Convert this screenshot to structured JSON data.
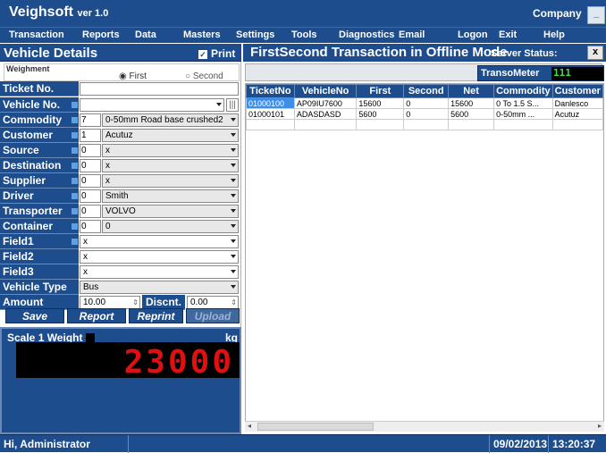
{
  "app": {
    "title": "Veighsoft",
    "version": "ver 1.0",
    "company": "Company",
    "minimize": "_"
  },
  "menu": [
    "Transaction",
    "Reports",
    "Data",
    "Masters",
    "Settings",
    "Tools",
    "Diagnostics",
    "Email",
    "Logon",
    "Exit",
    "Help"
  ],
  "left_panel": {
    "title": "Vehicle Details",
    "print_label": "Print",
    "weighment": {
      "label": "Weighment",
      "first": "First",
      "second": "Second"
    },
    "fields": {
      "ticket": {
        "label": "Ticket No.",
        "value": ""
      },
      "vehicle": {
        "label": "Vehicle No.",
        "value": ""
      },
      "commodity": {
        "label": "Commodity",
        "code": "7",
        "value": "0-50mm Road base crushed2"
      },
      "customer": {
        "label": "Customer",
        "code": "1",
        "value": "Acutuz"
      },
      "source": {
        "label": "Source",
        "code": "0",
        "value": "x"
      },
      "destination": {
        "label": "Destination",
        "code": "0",
        "value": "x"
      },
      "supplier": {
        "label": "Supplier",
        "code": "0",
        "value": "x"
      },
      "driver": {
        "label": "Driver",
        "code": "0",
        "value": "Smith"
      },
      "transporter": {
        "label": "Transporter",
        "code": "0",
        "value": "VOLVO"
      },
      "container": {
        "label": "Container",
        "code": "0",
        "value": "0"
      },
      "field1": {
        "label": "Field1",
        "value": "x"
      },
      "field2": {
        "label": "Field2",
        "value": "x"
      },
      "field3": {
        "label": "Field3",
        "value": "x"
      },
      "vehicle_type": {
        "label": "Vehicle Type",
        "value": "Bus"
      },
      "amount": {
        "label": "Amount",
        "value": "10.00",
        "discount_label": "Discnt.",
        "discount_value": "0.00"
      }
    },
    "buttons": {
      "save": "Save",
      "report": "Report",
      "reprint": "Reprint",
      "upload": "Upload"
    }
  },
  "scale": {
    "label": "Scale 1 Weight",
    "unit": "kg",
    "value": "23000"
  },
  "right_panel": {
    "title": "FirstSecond Transaction in Offline Mode",
    "server_status": "Server Status:",
    "close": "x",
    "transometer_label": "TransoMeter",
    "transometer_value": "111",
    "columns": [
      "TicketNo",
      "VehicleNo",
      "First",
      "Second",
      "Net",
      "Commodity",
      "Customer"
    ],
    "rows": [
      [
        "01000100",
        "AP09IU7600",
        "15600",
        "0",
        "15600",
        "0 To 1.5 S...",
        "Danlesco"
      ],
      [
        "01000101",
        "ADASDASD",
        "5600",
        "0",
        "5600",
        "0-50mm ...",
        "Acutuz"
      ]
    ]
  },
  "status": {
    "user": "Hi, Administrator",
    "date": "09/02/2013",
    "time": "13:20:37"
  },
  "colors": {
    "primary": "#1d4d8c",
    "scale_digits": "#e01010",
    "meter_digits": "#3fe03f",
    "selection": "#3b8eea"
  }
}
